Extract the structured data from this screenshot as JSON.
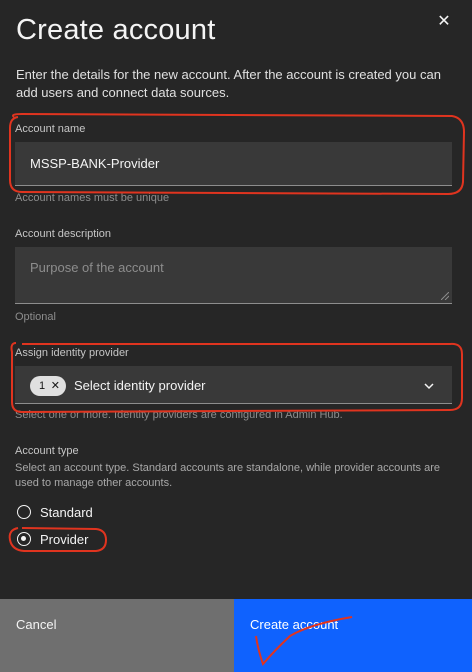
{
  "modal": {
    "title": "Create account",
    "description": "Enter the details for the new account. After the account is created you can add users and connect data sources.",
    "close_icon": "close-icon"
  },
  "account_name": {
    "label": "Account name",
    "value": "MSSP-BANK-Provider",
    "helper": "Account names must be unique"
  },
  "account_description": {
    "label": "Account description",
    "placeholder": "Purpose of the account",
    "helper": "Optional"
  },
  "identity_provider": {
    "label": "Assign identity provider",
    "selected_count": "1",
    "tag_clear": "✕",
    "placeholder": "Select identity provider",
    "helper": "Select one or more. Identity providers are configured in Admin Hub.",
    "icon": "chevron-down-icon"
  },
  "account_type": {
    "label": "Account type",
    "helper": "Select an account type. Standard accounts are standalone, while provider accounts are used to manage other accounts.",
    "options": [
      {
        "label": "Standard",
        "checked": false
      },
      {
        "label": "Provider",
        "checked": true
      }
    ]
  },
  "footer": {
    "cancel_label": "Cancel",
    "create_label": "Create account"
  },
  "colors": {
    "background": "#262626",
    "field": "#393939",
    "primary": "#0f62fe",
    "secondary": "#6f6f6f",
    "annotation": "#e0341f"
  }
}
